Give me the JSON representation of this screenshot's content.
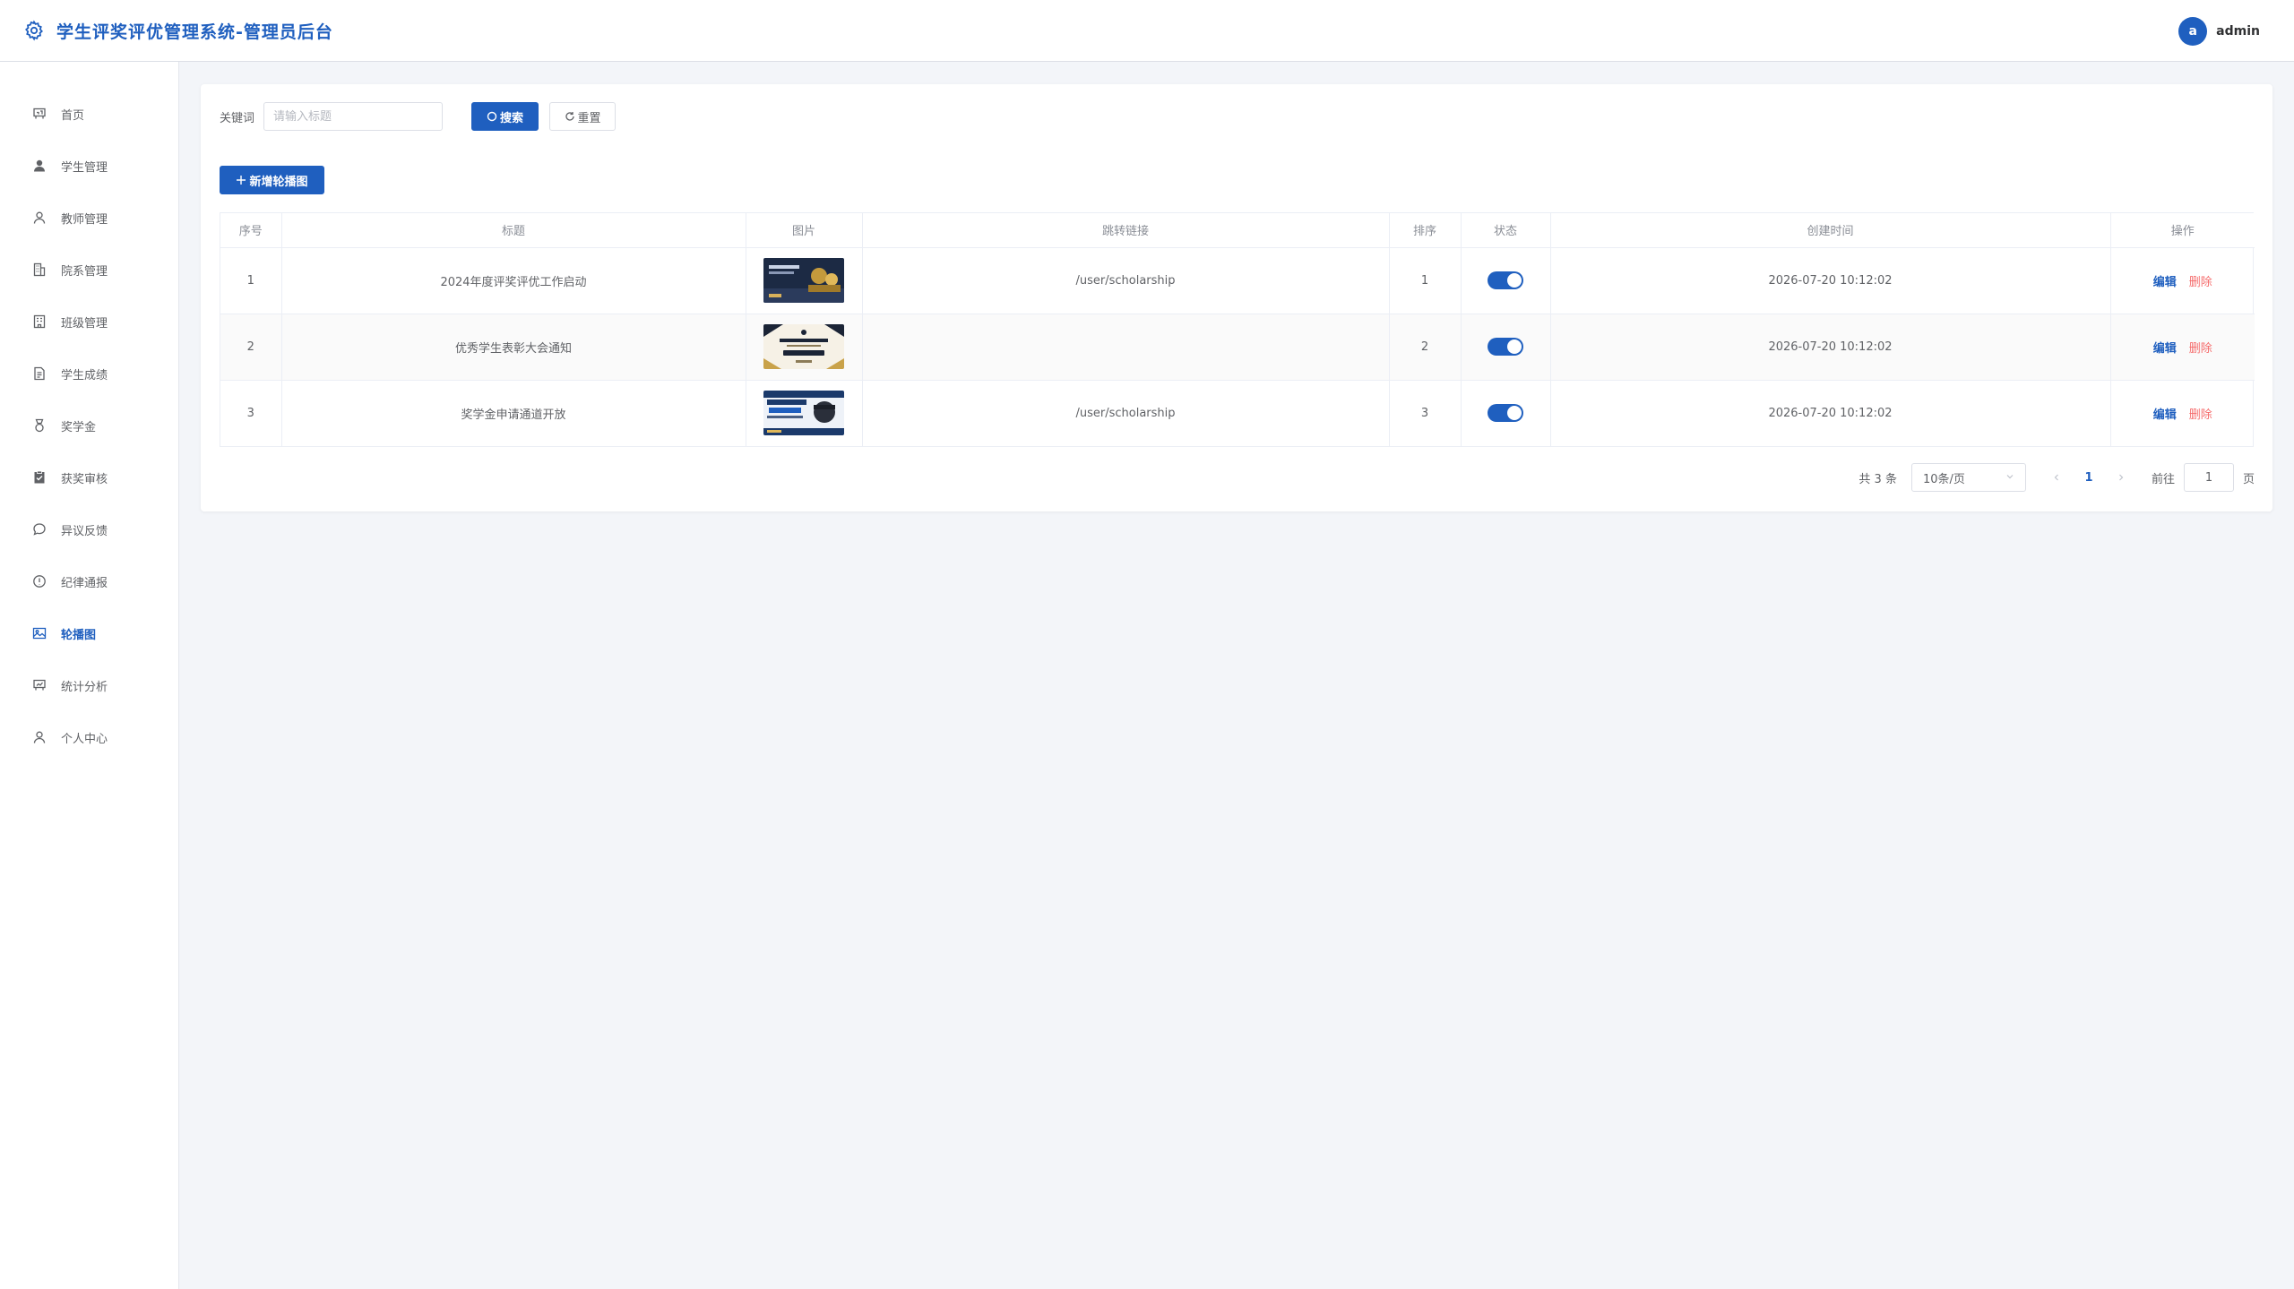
{
  "header": {
    "title": "学生评奖评优管理系统-管理员后台",
    "avatar_letter": "a",
    "username": "admin",
    "accent": "#1f5fbf"
  },
  "sidebar": {
    "items": [
      {
        "label": "首页",
        "icon": "home-icon",
        "active": false
      },
      {
        "label": "学生管理",
        "icon": "user-solid-icon",
        "active": false
      },
      {
        "label": "教师管理",
        "icon": "user-icon",
        "active": false
      },
      {
        "label": "院系管理",
        "icon": "building-icon",
        "active": false
      },
      {
        "label": "班级管理",
        "icon": "office-icon",
        "active": false
      },
      {
        "label": "学生成绩",
        "icon": "document-icon",
        "active": false
      },
      {
        "label": "奖学金",
        "icon": "medal-icon",
        "active": false
      },
      {
        "label": "获奖审核",
        "icon": "checklist-icon",
        "active": false
      },
      {
        "label": "异议反馈",
        "icon": "chat-icon",
        "active": false
      },
      {
        "label": "纪律通报",
        "icon": "warning-icon",
        "active": false
      },
      {
        "label": "轮播图",
        "icon": "picture-icon",
        "active": true
      },
      {
        "label": "统计分析",
        "icon": "chart-icon",
        "active": false
      },
      {
        "label": "个人中心",
        "icon": "user-icon",
        "active": false
      }
    ]
  },
  "search": {
    "label": "关键词",
    "placeholder": "请输入标题",
    "value": "",
    "search_button": "搜索",
    "reset_button": "重置"
  },
  "add_button": "新增轮播图",
  "table": {
    "columns": [
      "序号",
      "标题",
      "图片",
      "跳转链接",
      "排序",
      "状态",
      "创建时间",
      "操作"
    ],
    "rows": [
      {
        "index": "1",
        "title": "2024年度评奖评优工作启动",
        "image": "banner-graduation-dark",
        "link": "/user/scholarship",
        "sort": "1",
        "status": true,
        "created": "2026-07-20 10:12:02"
      },
      {
        "index": "2",
        "title": "优秀学生表彰大会通知",
        "image": "banner-outstanding-student",
        "link": "",
        "sort": "2",
        "status": true,
        "created": "2026-07-20 10:12:02"
      },
      {
        "index": "3",
        "title": "奖学金申请通道开放",
        "image": "banner-scholarship",
        "link": "/user/scholarship",
        "sort": "3",
        "status": true,
        "created": "2026-07-20 10:12:02"
      }
    ],
    "edit_label": "编辑",
    "delete_label": "删除"
  },
  "pagination": {
    "total_text": "共 3 条",
    "page_size": "10条/页",
    "current_page": "1",
    "goto_label": "前往",
    "goto_value": "1",
    "page_unit": "页"
  }
}
